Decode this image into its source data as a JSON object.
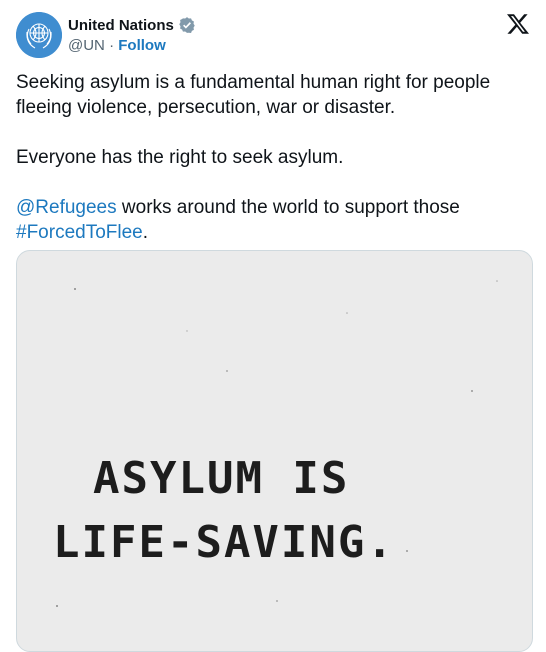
{
  "tweet": {
    "author": {
      "name": "United Nations",
      "handle": "@UN",
      "separator": "·",
      "follow_label": "Follow"
    },
    "body": {
      "p1": "Seeking asylum is a fundamental human right for people fleeing violence, persecution, war or disaster.",
      "p2": "Everyone has the right to seek asylum.",
      "p3_mention": "@Refugees",
      "p3_text": " works around the world to support those ",
      "p3_hashtag": "#ForcedToFlee",
      "p3_end": "."
    },
    "media": {
      "line1": "ASYLUM IS",
      "line2": "LIFE-SAVING."
    }
  },
  "icons": {
    "avatar": "un-emblem-icon",
    "verified": "verified-badge-icon",
    "platform": "x-logo-icon"
  },
  "colors": {
    "link": "#1d79bf",
    "avatar_bg": "#3f8dd0",
    "text": "#0f1419",
    "muted": "#536471"
  }
}
